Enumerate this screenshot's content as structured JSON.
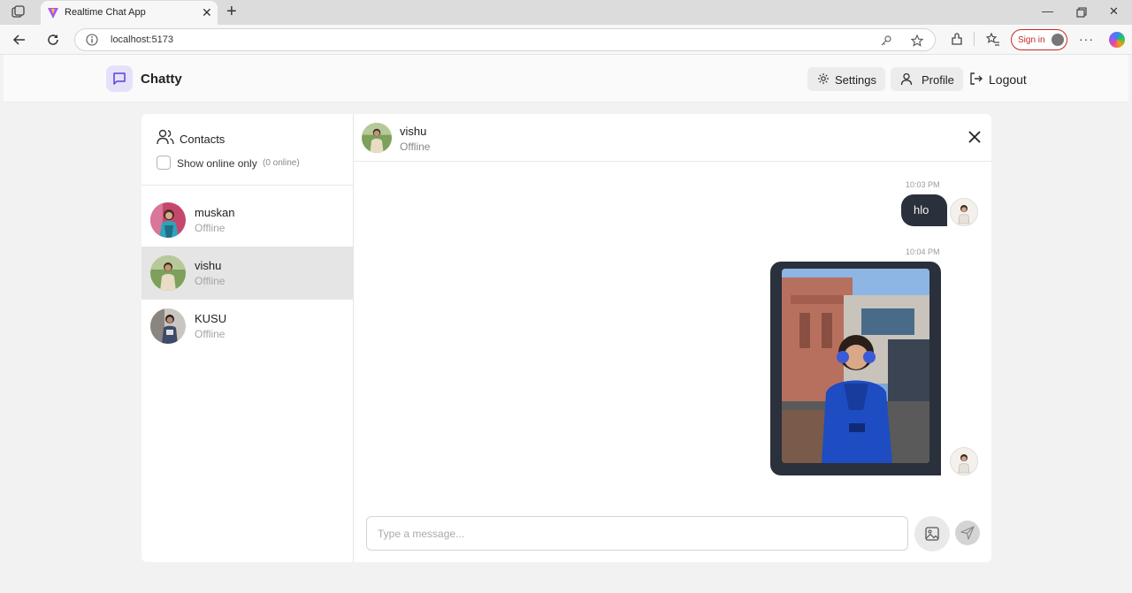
{
  "browser": {
    "tab_title": "Realtime Chat App",
    "url": "localhost:5173",
    "signin_label": "Sign in"
  },
  "header": {
    "brand": "Chatty",
    "settings_label": "Settings",
    "profile_label": "Profile",
    "logout_label": "Logout"
  },
  "sidebar": {
    "title": "Contacts",
    "filter_label": "Show online only",
    "online_count": "(0 online)",
    "contacts": [
      {
        "name": "muskan",
        "status": "Offline",
        "selected": false
      },
      {
        "name": "vishu",
        "status": "Offline",
        "selected": true
      },
      {
        "name": "KUSU",
        "status": "Offline",
        "selected": false
      }
    ]
  },
  "chat": {
    "name": "vishu",
    "status": "Offline",
    "messages": [
      {
        "time": "10:03 PM",
        "type": "text",
        "text": "hlo"
      },
      {
        "time": "10:04 PM",
        "type": "image"
      }
    ],
    "composer_placeholder": "Type a message..."
  },
  "colors": {
    "accent": "#e6e1fb",
    "accent_icon": "#5b3fd6",
    "bubble": "#2a303c",
    "signin": "#c62828"
  }
}
